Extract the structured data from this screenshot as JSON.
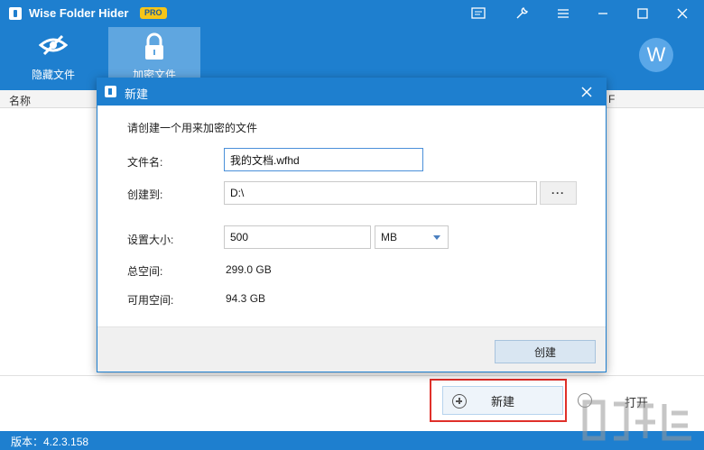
{
  "app": {
    "title": "Wise Folder Hider",
    "badge": "PRO",
    "accent_color": "#1e7fcf",
    "avatar_letter": "W"
  },
  "window_controls": {
    "icons": [
      "message-icon",
      "tools-icon",
      "menu-icon",
      "minimize-icon",
      "maximize-icon",
      "close-icon"
    ]
  },
  "toolbar": {
    "hide_files_label": "隐藏文件",
    "encrypt_files_label": "加密文件"
  },
  "list": {
    "columns": [
      "名称",
      "F"
    ]
  },
  "dialog": {
    "title": "新建",
    "prompt": "请创建一个用来加密的文件",
    "file_name_label": "文件名:",
    "file_name_value": "我的文档.wfhd",
    "create_to_label": "创建到:",
    "create_to_value": "D:\\",
    "browse_label": "···",
    "size_label": "设置大小:",
    "size_value": "500",
    "unit_value": "MB",
    "total_space_label": "总空间:",
    "total_space_value": "299.0 GB",
    "free_space_label": "可用空间:",
    "free_space_value": "94.3 GB",
    "create_button": "创建"
  },
  "bottom": {
    "new_button": "新建",
    "open_button": "打开"
  },
  "status": {
    "version": "版本：4.2.3.158"
  }
}
